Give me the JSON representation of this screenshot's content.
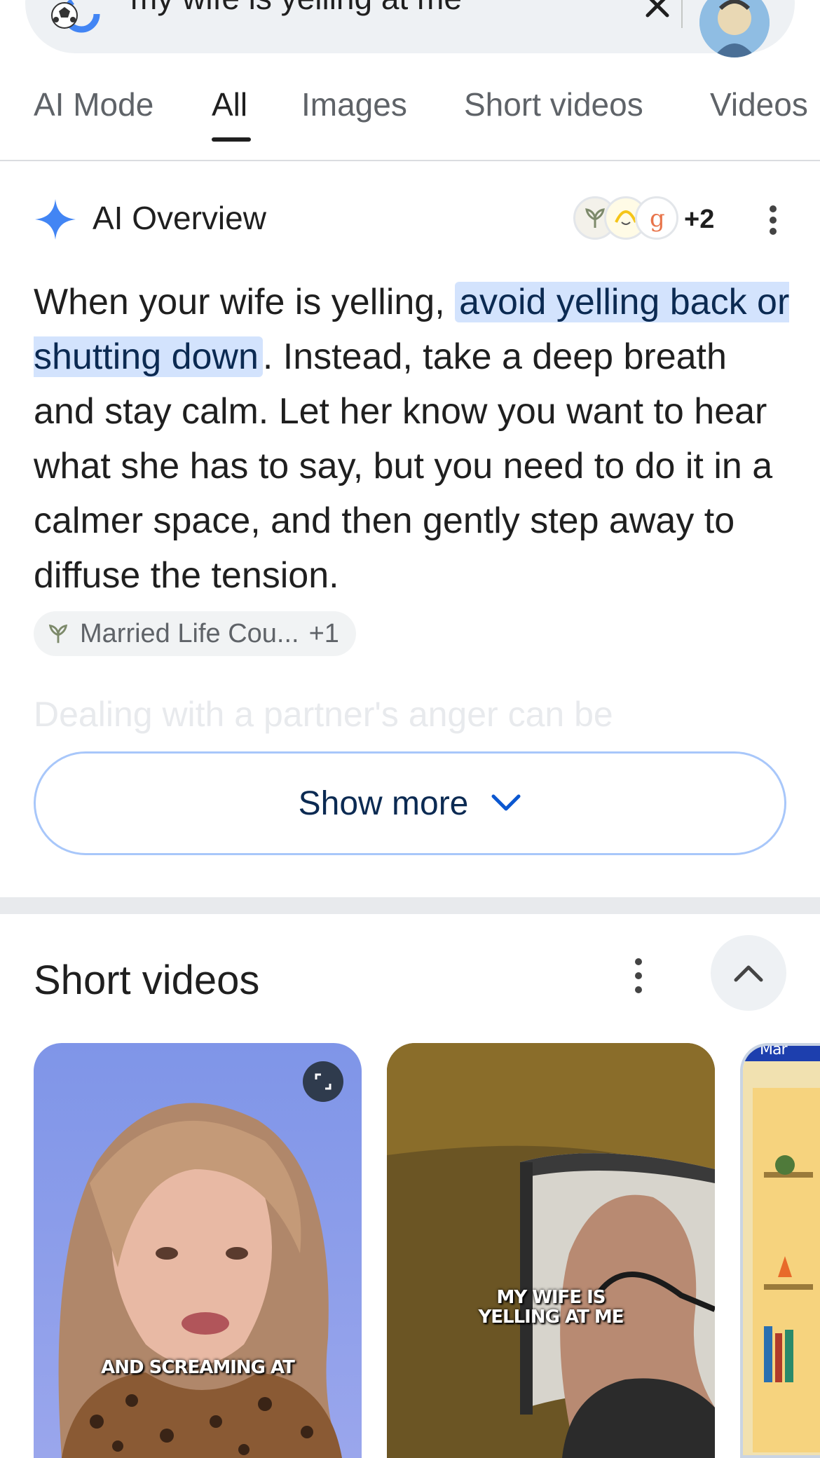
{
  "search": {
    "query": "my wife is yelling at me"
  },
  "tabs": [
    {
      "label": "AI Mode"
    },
    {
      "label": "All"
    },
    {
      "label": "Images"
    },
    {
      "label": "Short videos"
    },
    {
      "label": "Videos"
    }
  ],
  "active_tab": "All",
  "ai_overview": {
    "title": "AI Overview",
    "source_count_extra": "+2",
    "text_before": "When your wife is yelling, ",
    "text_highlight": "avoid yelling back or shutting down",
    "text_after": ". Instead, take a deep breath and stay calm. Let her know you want to hear what she has to say, but you need to do it in a calmer space, and then gently step away to diffuse the tension.",
    "source_chip_label": "Married Life Cou...",
    "source_chip_extra": "+1",
    "faded_text": "Dealing with a partner's anger can be",
    "show_more_label": "Show more"
  },
  "short_videos": {
    "title": "Short videos",
    "videos": [
      {
        "caption": "AND SCREAMING AT"
      },
      {
        "caption_line1": "MY WIFE IS",
        "caption_line2": "YELLING AT ME"
      },
      {
        "caption": "Mar"
      }
    ]
  },
  "colors": {
    "highlight": "#d3e3fd",
    "show_more_border": "#a8c7fa",
    "link_blue": "#0b2a52",
    "sparkle": "#4285f4"
  }
}
